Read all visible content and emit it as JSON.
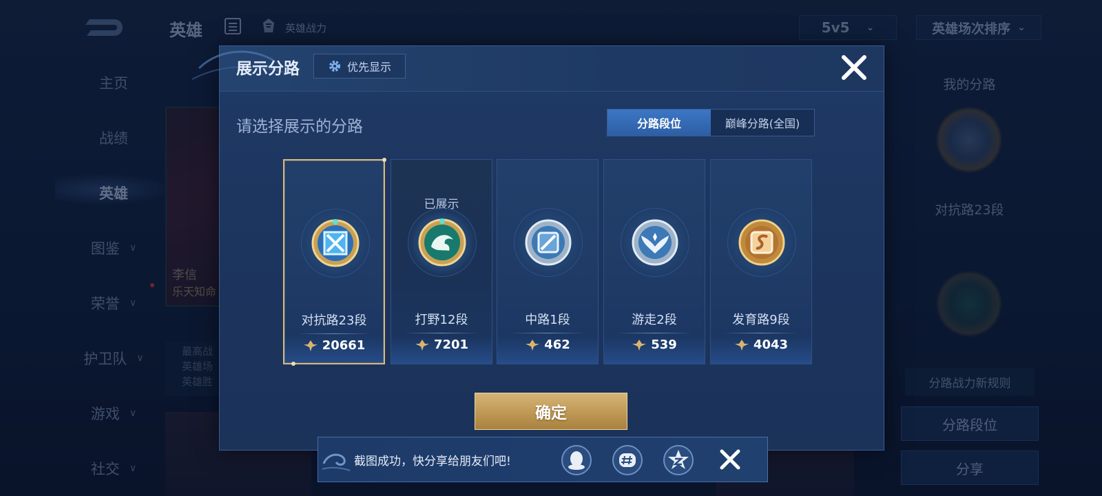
{
  "background": {
    "title": "英雄",
    "subtitle": "英雄战力",
    "mode_select": "5v5",
    "sort_select": "英雄场次排序",
    "nav": [
      {
        "label": "主页",
        "chevron": false,
        "active": false
      },
      {
        "label": "战绩",
        "chevron": false,
        "active": false
      },
      {
        "label": "英雄",
        "chevron": false,
        "active": true
      },
      {
        "label": "图鉴",
        "chevron": true,
        "active": false
      },
      {
        "label": "荣誉",
        "chevron": true,
        "active": false
      },
      {
        "label": "护卫队",
        "chevron": true,
        "active": false
      },
      {
        "label": "游戏",
        "chevron": true,
        "active": false
      },
      {
        "label": "社交",
        "chevron": true,
        "active": false
      }
    ],
    "hero_name": "李信",
    "hero_skin": "乐天知命",
    "hero_stats": [
      "最高战",
      "英雄场",
      "英雄胜"
    ],
    "right_panel": {
      "title": "我的分路",
      "current_lane": "对抗路23段",
      "rules_button": "分路战力新规则",
      "lane_rank_button": "分路段位",
      "share_button": "分享"
    }
  },
  "modal": {
    "title": "展示分路",
    "priority_button": "优先显示",
    "prompt": "请选择展示的分路",
    "tabs": [
      {
        "label": "分路段位",
        "active": true
      },
      {
        "label": "巅峰分路(全国)",
        "active": false
      }
    ],
    "lanes": [
      {
        "name": "对抗路23段",
        "power": "20661",
        "selected": true,
        "shown": false,
        "emblem": "clash-lane-emblem"
      },
      {
        "name": "打野12段",
        "power": "7201",
        "selected": false,
        "shown": true,
        "emblem": "jungle-emblem"
      },
      {
        "name": "中路1段",
        "power": "462",
        "selected": false,
        "shown": false,
        "emblem": "mid-lane-emblem"
      },
      {
        "name": "游走2段",
        "power": "539",
        "selected": false,
        "shown": false,
        "emblem": "roam-emblem"
      },
      {
        "name": "发育路9段",
        "power": "4043",
        "selected": false,
        "shown": false,
        "emblem": "farm-lane-emblem"
      }
    ],
    "shown_label": "已展示",
    "confirm_button": "确定"
  },
  "toast": {
    "message": "截图成功，快分享给朋友们吧!",
    "share_targets": [
      "qq-icon",
      "wechat-moments-icon",
      "qzone-icon"
    ]
  },
  "colors": {
    "gold": "#d9b979",
    "tab_active": "#3c77c4",
    "modal_bg": "#1f3a66"
  }
}
